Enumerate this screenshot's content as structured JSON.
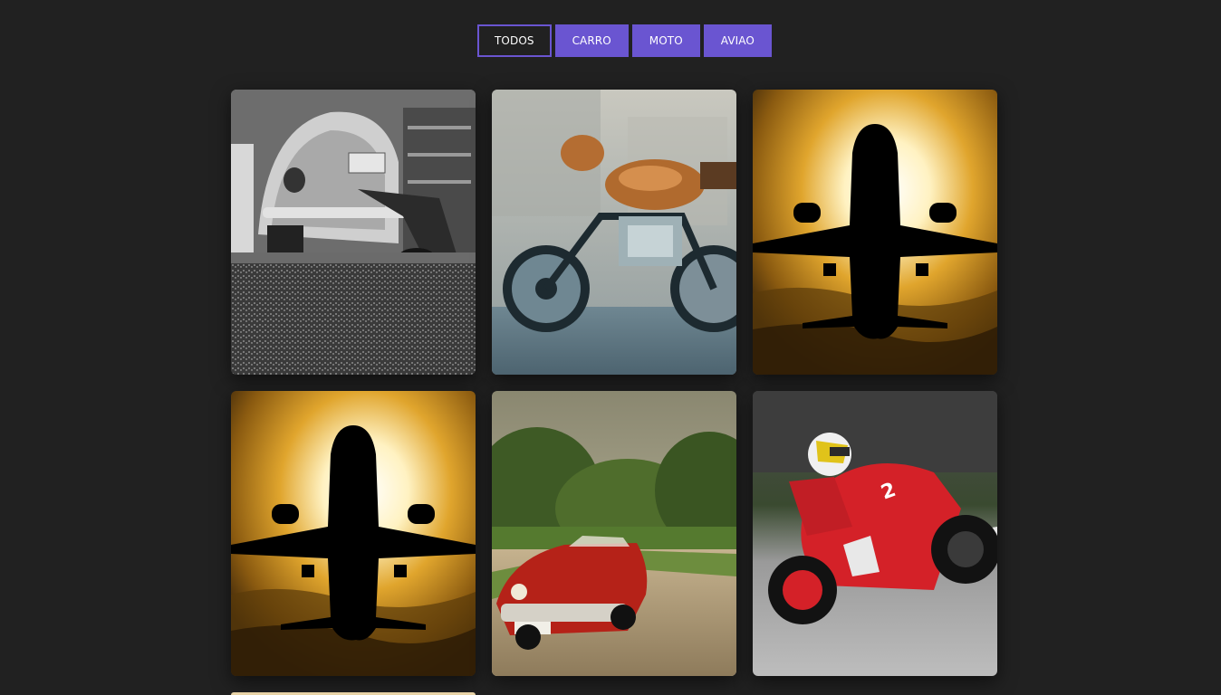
{
  "filters": {
    "items": [
      {
        "label": "TODOS",
        "active": true
      },
      {
        "label": "CARRO",
        "active": false
      },
      {
        "label": "MOTO",
        "active": false
      },
      {
        "label": "AVIAO",
        "active": false
      }
    ],
    "accent_color": "#6a55d1"
  },
  "gallery": {
    "items": [
      {
        "category": "carro",
        "icon": "vintage-beetle-bw-photo"
      },
      {
        "category": "moto",
        "icon": "bronze-motorcycle-photo"
      },
      {
        "category": "aviao",
        "icon": "airplane-sunset-photo"
      },
      {
        "category": "aviao",
        "icon": "airplane-sunset-photo"
      },
      {
        "category": "carro",
        "icon": "red-classic-car-photo"
      },
      {
        "category": "moto",
        "icon": "racing-motorcycle-photo"
      }
    ],
    "background_color": "#212121"
  }
}
